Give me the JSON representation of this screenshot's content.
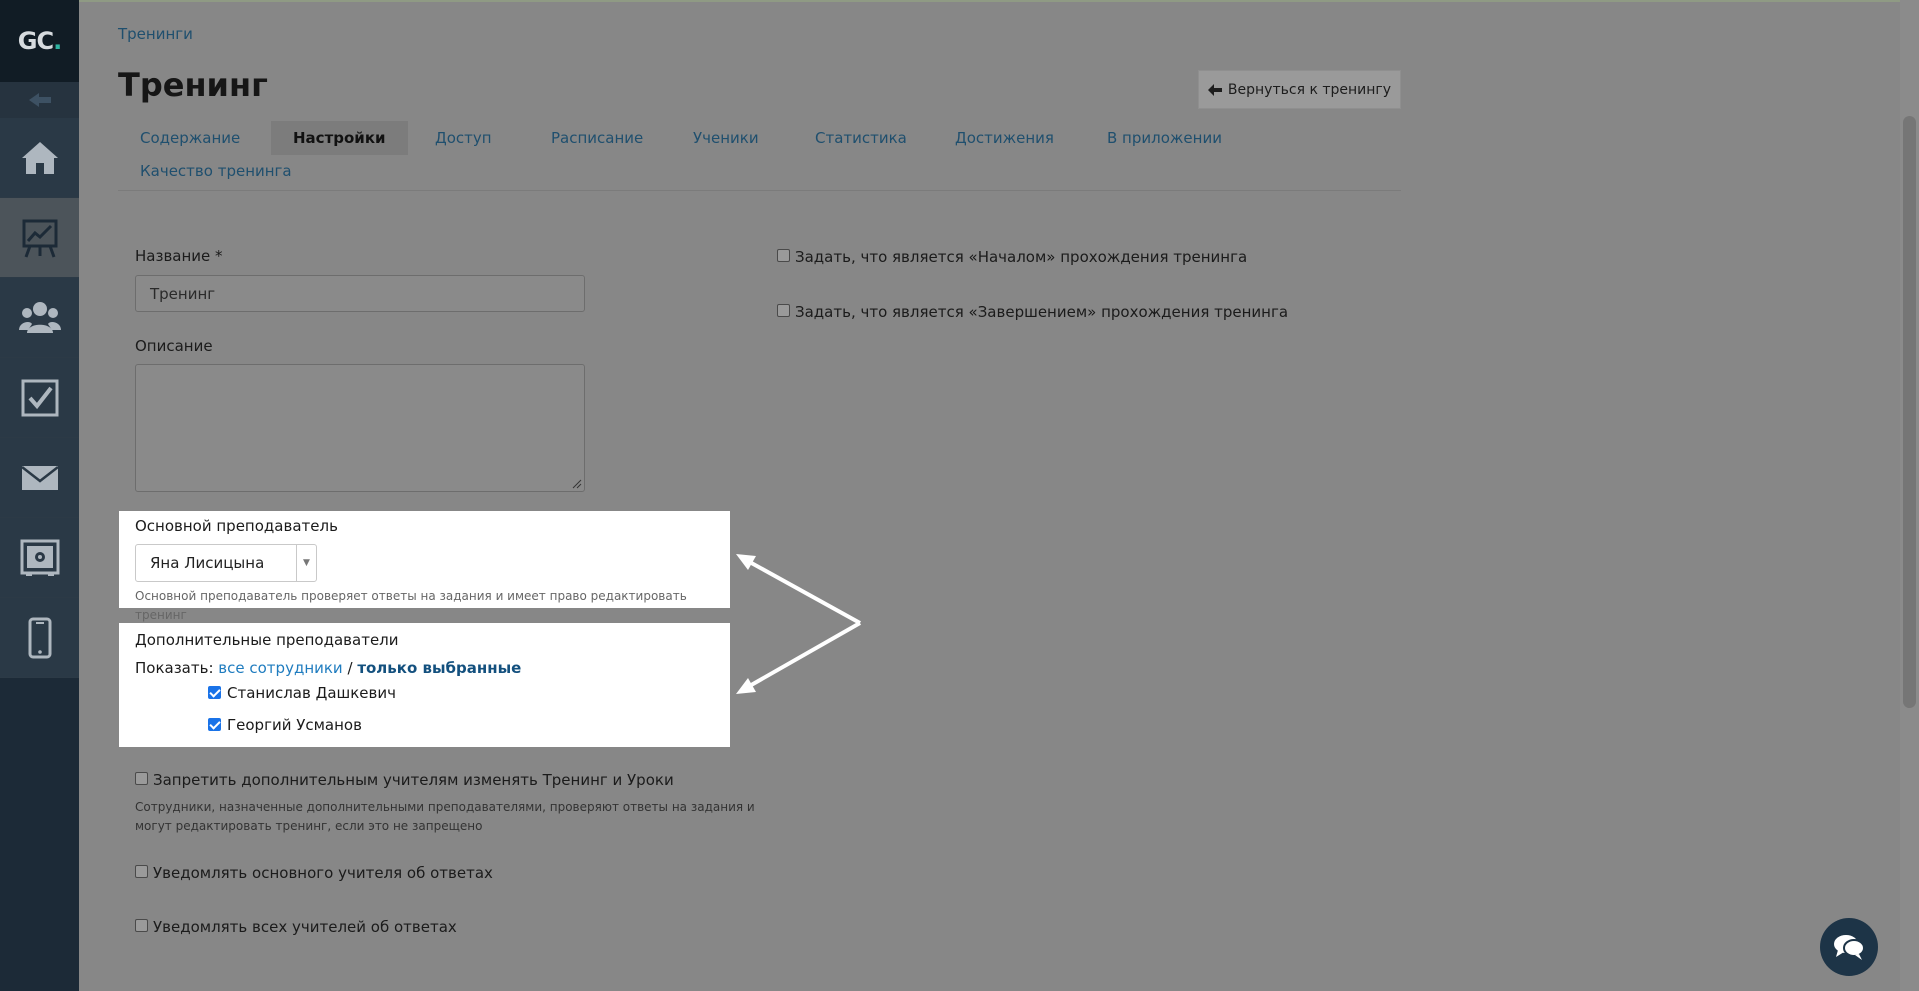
{
  "logo": {
    "text_main": "GC",
    "text_dot": "."
  },
  "sidebar": {
    "items": [
      {
        "name": "home",
        "icon": "home-icon"
      },
      {
        "name": "trainings",
        "icon": "chart-board-icon",
        "active": true
      },
      {
        "name": "users",
        "icon": "users-icon"
      },
      {
        "name": "tasks",
        "icon": "checkbox-icon"
      },
      {
        "name": "messages",
        "icon": "mail-icon"
      },
      {
        "name": "safe",
        "icon": "safe-icon"
      },
      {
        "name": "mobile",
        "icon": "phone-icon"
      }
    ]
  },
  "breadcrumb": "Тренинги",
  "page_title": "Тренинг",
  "back_button": "Вернуться к тренингу",
  "tabs": [
    {
      "label": "Содержание"
    },
    {
      "label": "Настройки",
      "active": true
    },
    {
      "label": "Доступ"
    },
    {
      "label": "Расписание"
    },
    {
      "label": "Ученики"
    },
    {
      "label": "Статистика"
    },
    {
      "label": "Достижения"
    },
    {
      "label": "В приложении"
    },
    {
      "label": "Качество тренинга"
    }
  ],
  "form": {
    "name_label": "Название *",
    "name_value": "Тренинг",
    "description_label": "Описание",
    "main_teacher_label": "Основной преподаватель",
    "main_teacher_value": "Яна Лисицына",
    "main_teacher_hint": "Основной преподаватель проверяет ответы на задания и имеет право редактировать тренинг",
    "extra_teachers_label": "Дополнительные преподаватели",
    "show_label": "Показать:",
    "show_all": "все сотрудники",
    "show_sep": "/",
    "show_selected": "только выбранные",
    "extra_teachers": [
      {
        "name": "Станислав Дашкевич",
        "checked": true
      },
      {
        "name": "Георгий Усманов",
        "checked": true
      }
    ],
    "forbid_label": "Запретить дополнительным учителям изменять Тренинг и Уроки",
    "forbid_hint_1": "Сотрудники, назначенные дополнительными преподавателями, проверяют ответы на задания и",
    "forbid_hint_2": "могут редактировать тренинг, если это не запрещено",
    "notify_main_label": "Уведомлять основного учителя об ответах",
    "notify_all_label": "Уведомлять всех учителей об ответах",
    "start_label": "Задать, что является «Началом» прохождения тренинга",
    "finish_label": "Задать, что является «Завершением» прохождения тренинга"
  },
  "colors": {
    "accent": "#1f7cbf",
    "sidebar": "#1c2a37",
    "logo_dot": "#2fb3a1"
  }
}
